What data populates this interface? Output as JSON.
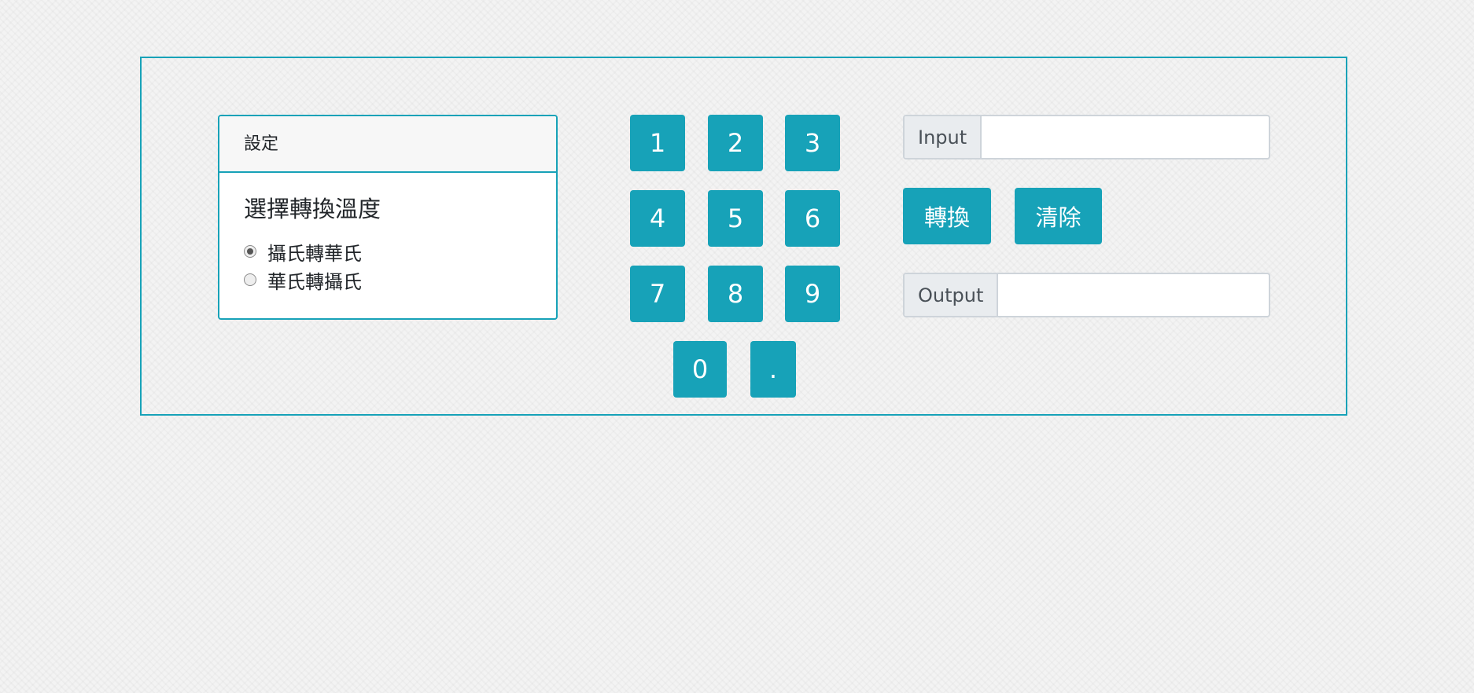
{
  "settings": {
    "header": "設定",
    "title": "選擇轉換溫度",
    "options": [
      {
        "label": "攝氏轉華氏",
        "checked": true
      },
      {
        "label": "華氏轉攝氏",
        "checked": false
      }
    ]
  },
  "keypad": {
    "keys": [
      "1",
      "2",
      "3",
      "4",
      "5",
      "6",
      "7",
      "8",
      "9",
      "0",
      "."
    ]
  },
  "input": {
    "label": "Input",
    "value": ""
  },
  "output": {
    "label": "Output",
    "value": ""
  },
  "buttons": {
    "convert": "轉換",
    "clear": "清除"
  },
  "colors": {
    "accent": "#17a2b8"
  }
}
